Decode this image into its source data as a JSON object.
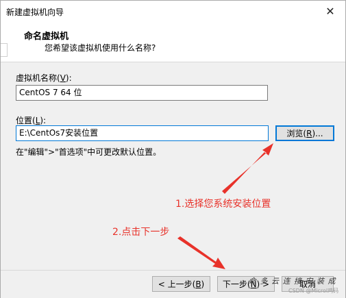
{
  "window": {
    "title": "新建虚拟机向导",
    "close_glyph": "✕"
  },
  "header": {
    "title": "命名虚拟机",
    "subtitle": "您希望该虚拟机使用什么名称?"
  },
  "name_field": {
    "label_prefix": "虚拟机名称(",
    "label_key": "V",
    "label_suffix": "):",
    "value": "CentOS 7 64 位"
  },
  "location_field": {
    "label_prefix": "位置(",
    "label_key": "L",
    "label_suffix": "):",
    "value": "E:\\CentOs7安装位置",
    "browse_prefix": "浏览(",
    "browse_key": "R",
    "browse_suffix": ")..."
  },
  "hint": "在\"编辑\">\"首选项\"中可更改默认位置。",
  "annotations": {
    "note1": "1.选择您系统安装位置",
    "note2": "2.点击下一步",
    "color": "#e8322a"
  },
  "footer": {
    "back_prefix": "< 上一步(",
    "back_key": "B",
    "back_suffix": ")",
    "next_prefix": "下一步(",
    "next_key": "N",
    "next_suffix": ") >",
    "cancel_label": "取消"
  },
  "watermark": {
    "text": "命 多 云 连 接 安 装 成",
    "csdn": "CSDN @Microl鸡码"
  }
}
